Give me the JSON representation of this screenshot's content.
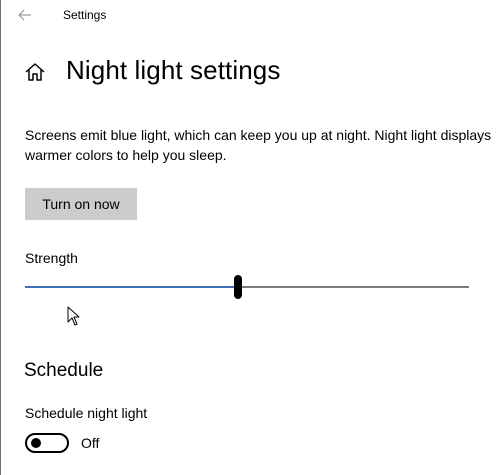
{
  "window": {
    "title": "Settings"
  },
  "icons": {
    "back": "back-arrow-icon",
    "home": "home-icon",
    "cursor": "mouse-pointer-icon"
  },
  "page": {
    "title": "Night light settings",
    "description": "Screens emit blue light, which can keep you up at night. Night light displays warmer colors to help you sleep."
  },
  "actions": {
    "turn_on_label": "Turn on now"
  },
  "strength": {
    "label": "Strength",
    "value_percent": 48,
    "fill_color": "#3b6fb6",
    "track_color": "#7a7a7a"
  },
  "schedule": {
    "heading": "Schedule",
    "toggle_label": "Schedule night light",
    "toggle_on": false,
    "toggle_state_text": "Off"
  },
  "colors": {
    "button_bg": "#cccccc",
    "accent": "#3b6fb6"
  }
}
